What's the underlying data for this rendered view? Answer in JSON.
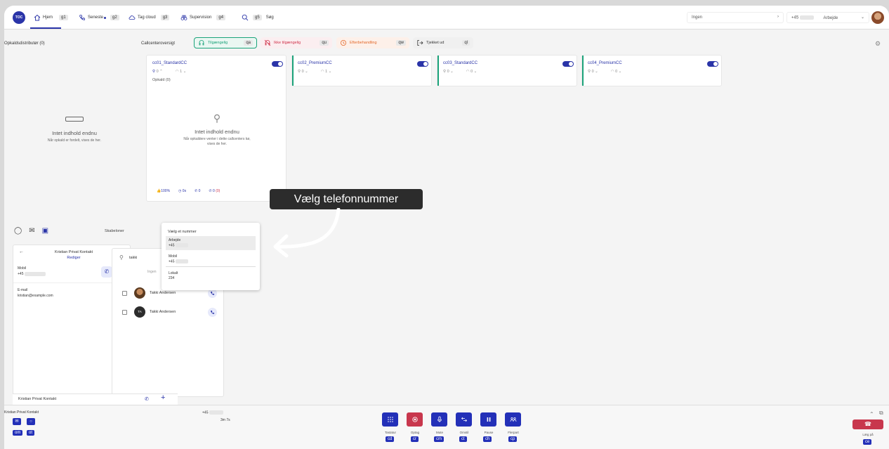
{
  "topbar": {
    "logo": "TOC",
    "nav": [
      {
        "label": "Hjem",
        "key": "g1",
        "icon": "home-icon"
      },
      {
        "label": "Seneste",
        "key": "g2",
        "icon": "phone-icon"
      },
      {
        "label": "Tag cloud",
        "key": "g3",
        "icon": "cloud-icon"
      },
      {
        "label": "Supervision",
        "key": "g4",
        "icon": "binoculars-icon"
      },
      {
        "label": "",
        "key": "g5",
        "icon": "search-icon"
      },
      {
        "label": "Søg",
        "key": "",
        "icon": ""
      }
    ],
    "queue_select": "Ingen",
    "number_prefix": "+45",
    "number_type": "Arbejde"
  },
  "distributor": {
    "title": "Opkaldsdistributør (0)",
    "empty_title": "Intet indhold endnu",
    "empty_sub": "Når opkald er fordelt, vises de her."
  },
  "callcenter": {
    "title": "Callcenteroversigt",
    "statuses": [
      {
        "label": "Tilgængelig",
        "key": "qa",
        "color": "#1ba37a"
      },
      {
        "label": "Ikke tilgængelig",
        "key": "qu",
        "color": "#d0344c"
      },
      {
        "label": "Efterbehandling",
        "key": "qw",
        "color": "#e36a2c"
      },
      {
        "label": "Tjekket ud",
        "key": "ql",
        "color": "#333333"
      }
    ],
    "cards": [
      {
        "name": "cc01_StandardCC",
        "agents": "0",
        "queue": "1",
        "calls_label": "Opkald (0)"
      },
      {
        "name": "cc02_PremiumCC",
        "agents": "0",
        "queue": "1"
      },
      {
        "name": "cc03_StandardCC",
        "agents": "0",
        "queue": "0"
      },
      {
        "name": "cc04_PremiumCC",
        "agents": "0",
        "queue": "0"
      }
    ],
    "empty_title": "Intet indhold endnu",
    "empty_sub": "Når opkaldere venter i dette callcenters kø, vises de her.",
    "footer_stats": [
      "100%",
      "0s",
      "0",
      "0",
      "(0)"
    ]
  },
  "tooltip": "Vælg telefonnummer",
  "contact_panel": {
    "templates_label": "Skabeloner",
    "contact_name": "Kristian Privat Kontakt",
    "edit_label": "Rediger",
    "mobile_label": "Mobil",
    "mobile_prefix": "+45",
    "email_label": "E-mail",
    "email": "kristian@example.com",
    "tab_label": "Kristian Privat Kontakt"
  },
  "search": {
    "query": "takki",
    "partial_text": "Ingen",
    "results": [
      {
        "name": "Takki Andersen",
        "initials": ""
      },
      {
        "name": "Takki Andersen",
        "initials": "TA"
      }
    ]
  },
  "number_dropdown": {
    "heading": "Vælg et nummer",
    "items": [
      {
        "type": "Arbejde",
        "number": "+45"
      },
      {
        "type": "Mobil",
        "number": "+45"
      },
      {
        "type": "Lokalt",
        "number": "234"
      }
    ]
  },
  "bottom": {
    "caller_name": "Kristian Privat Kontakt",
    "caller_number": "+45",
    "duration": "3m 7s",
    "left_keys": [
      "om",
      "ot"
    ],
    "controls": [
      {
        "label": "Tastatur",
        "key": "cd",
        "icon": "keypad-icon"
      },
      {
        "label": "Optag",
        "key": "cr",
        "icon": "record-icon"
      },
      {
        "label": "Mute",
        "key": "cm",
        "icon": "microphone-icon"
      },
      {
        "label": "Omstil",
        "key": "ct",
        "icon": "transfer-icon"
      },
      {
        "label": "Pause",
        "key": "ch",
        "icon": "pause-icon"
      },
      {
        "label": "Flerpart",
        "key": "cp",
        "icon": "conference-icon"
      }
    ],
    "hangup_label": "Læg på",
    "hangup_key": "ce"
  }
}
